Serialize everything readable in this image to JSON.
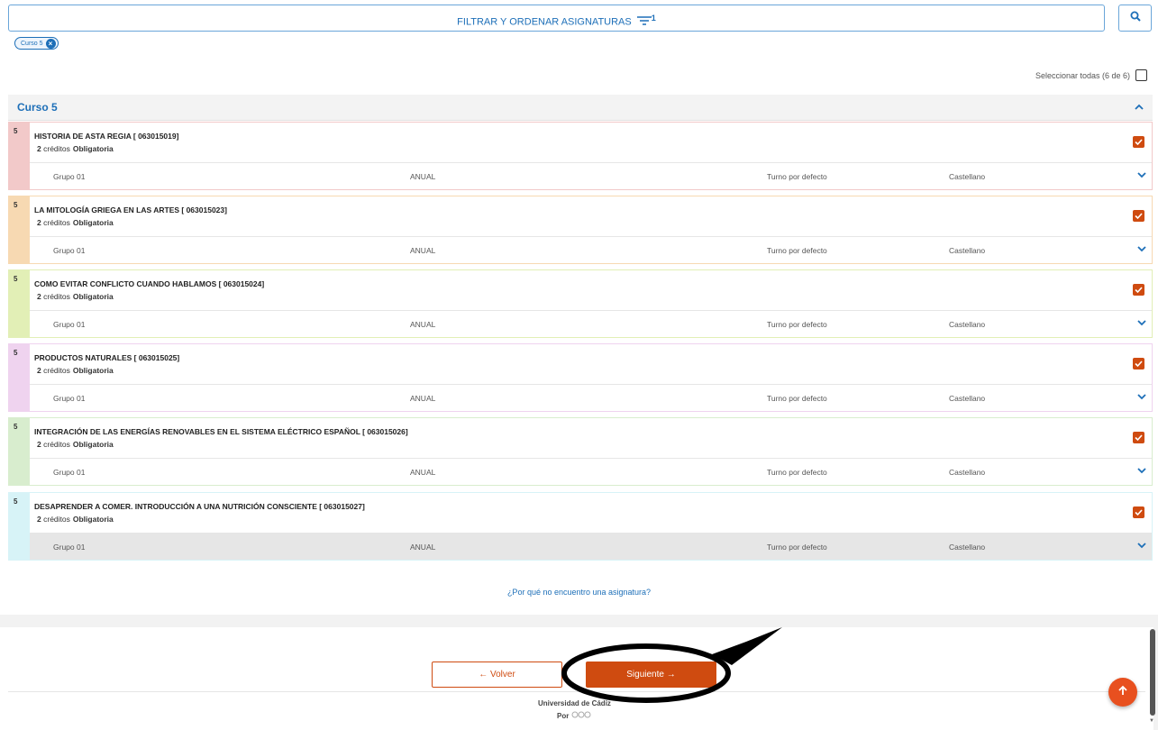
{
  "filter": {
    "label": "FILTRAR Y ORDENAR ASIGNATURAS",
    "count": "1"
  },
  "chip": {
    "label": "Curso 5"
  },
  "select_all": {
    "label": "Seleccionar todas (6 de 6)"
  },
  "course": {
    "title": "Curso 5"
  },
  "subjects": [
    {
      "num": "5",
      "name": "HISTORIA DE ASTA REGIA [ 063015019]",
      "credits": "2",
      "credits_label": "créditos",
      "type": "Obligatoria",
      "group": "Grupo 01",
      "period": "ANUAL",
      "shift": "Turno por defecto",
      "language": "Castellano",
      "color": "#f2c9c9"
    },
    {
      "num": "5",
      "name": "LA MITOLOGÍA GRIEGA EN LAS ARTES [ 063015023]",
      "credits": "2",
      "credits_label": "créditos",
      "type": "Obligatoria",
      "group": "Grupo 01",
      "period": "ANUAL",
      "shift": "Turno por defecto",
      "language": "Castellano",
      "color": "#f7d9b2"
    },
    {
      "num": "5",
      "name": "COMO EVITAR CONFLICTO CUANDO HABLAMOS [ 063015024]",
      "credits": "2",
      "credits_label": "créditos",
      "type": "Obligatoria",
      "group": "Grupo 01",
      "period": "ANUAL",
      "shift": "Turno por defecto",
      "language": "Castellano",
      "color": "#e2efb6"
    },
    {
      "num": "5",
      "name": "PRODUCTOS NATURALES [ 063015025]",
      "credits": "2",
      "credits_label": "créditos",
      "type": "Obligatoria",
      "group": "Grupo 01",
      "period": "ANUAL",
      "shift": "Turno por defecto",
      "language": "Castellano",
      "color": "#efd3ef"
    },
    {
      "num": "5",
      "name": "INTEGRACIÓN DE LAS ENERGÍAS RENOVABLES EN EL SISTEMA ELÉCTRICO ESPAÑOL [ 063015026]",
      "credits": "2",
      "credits_label": "créditos",
      "type": "Obligatoria",
      "group": "Grupo 01",
      "period": "ANUAL",
      "shift": "Turno por defecto",
      "language": "Castellano",
      "color": "#d8edce"
    },
    {
      "num": "5",
      "name": "DESAPRENDER A COMER. INTRODUCCIÓN A UNA NUTRICIÓN CONSCIENTE [ 063015027]",
      "credits": "2",
      "credits_label": "créditos",
      "type": "Obligatoria",
      "group": "Grupo 01",
      "period": "ANUAL",
      "shift": "Turno por defecto",
      "language": "Castellano",
      "color": "#d7f3f7"
    }
  ],
  "help_link": "¿Por qué no encuentro una asignatura?",
  "buttons": {
    "back": "← Volver",
    "next": "Siguiente →"
  },
  "footer": {
    "university": "Universidad de Cádiz",
    "by": "Por"
  },
  "colors": {
    "accent": "#cf4b10",
    "link": "#1d6fb8",
    "fab": "#e8501f"
  }
}
